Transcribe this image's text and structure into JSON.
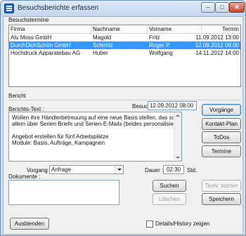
{
  "window": {
    "title": "Besuchsberichte erfassen"
  },
  "appointments": {
    "group_label": "Besuchstermine",
    "columns": [
      "Firma",
      "Nachname",
      "Vorname",
      "Termin"
    ],
    "rows": [
      [
        "Alu Moss GmbH",
        "Magold",
        "Fritz",
        "11.09.2012 13:00"
      ],
      [
        "DurchDichSchön GmbH",
        "Schmitz",
        "Roger P.",
        "12.09.2012 08:00"
      ],
      [
        "Hochdruck Apparatebau AG",
        "Huber",
        "Wolfgang",
        "14.11.2012 14:00"
      ]
    ],
    "selected_row": 1
  },
  "report": {
    "group_label": "Bericht",
    "visit_time_label": "Besuchs-Zeit :",
    "visit_time_value": "12.09.2012 08:00",
    "text_label": "Berichts-Text :",
    "text_lines": [
      "Wollen ihre Händlerbetreuung auf eine neue Basis stellen, das soll vor",
      "allem über Serien-Briefe und Serien-E-Mails (beides personalisiert) erfolgen",
      "",
      "Angebot erstellen für fünf Arbeitsplätze",
      "Module: Basis, Aufträge, Kampagnen"
    ],
    "process_label": "Vorgang :",
    "process_value": "Anfrage",
    "duration_label": "Dauer :",
    "duration_value": "02:30",
    "duration_unit": "Std.",
    "documents_label": "Dokumente :"
  },
  "buttons": {
    "vorgaenge": "Vorgänge",
    "kontakt_plan": "Kontakt-Plan",
    "todos": "ToDos",
    "termine": "Termine",
    "suchen": "Suchen",
    "loeschen": "Löschen",
    "textv_starten": "Textv. starten",
    "speichern": "Speichern",
    "ausblenden": "Ausblenden"
  },
  "details_checkbox": {
    "label": "Details/History zeigen",
    "checked": false
  }
}
